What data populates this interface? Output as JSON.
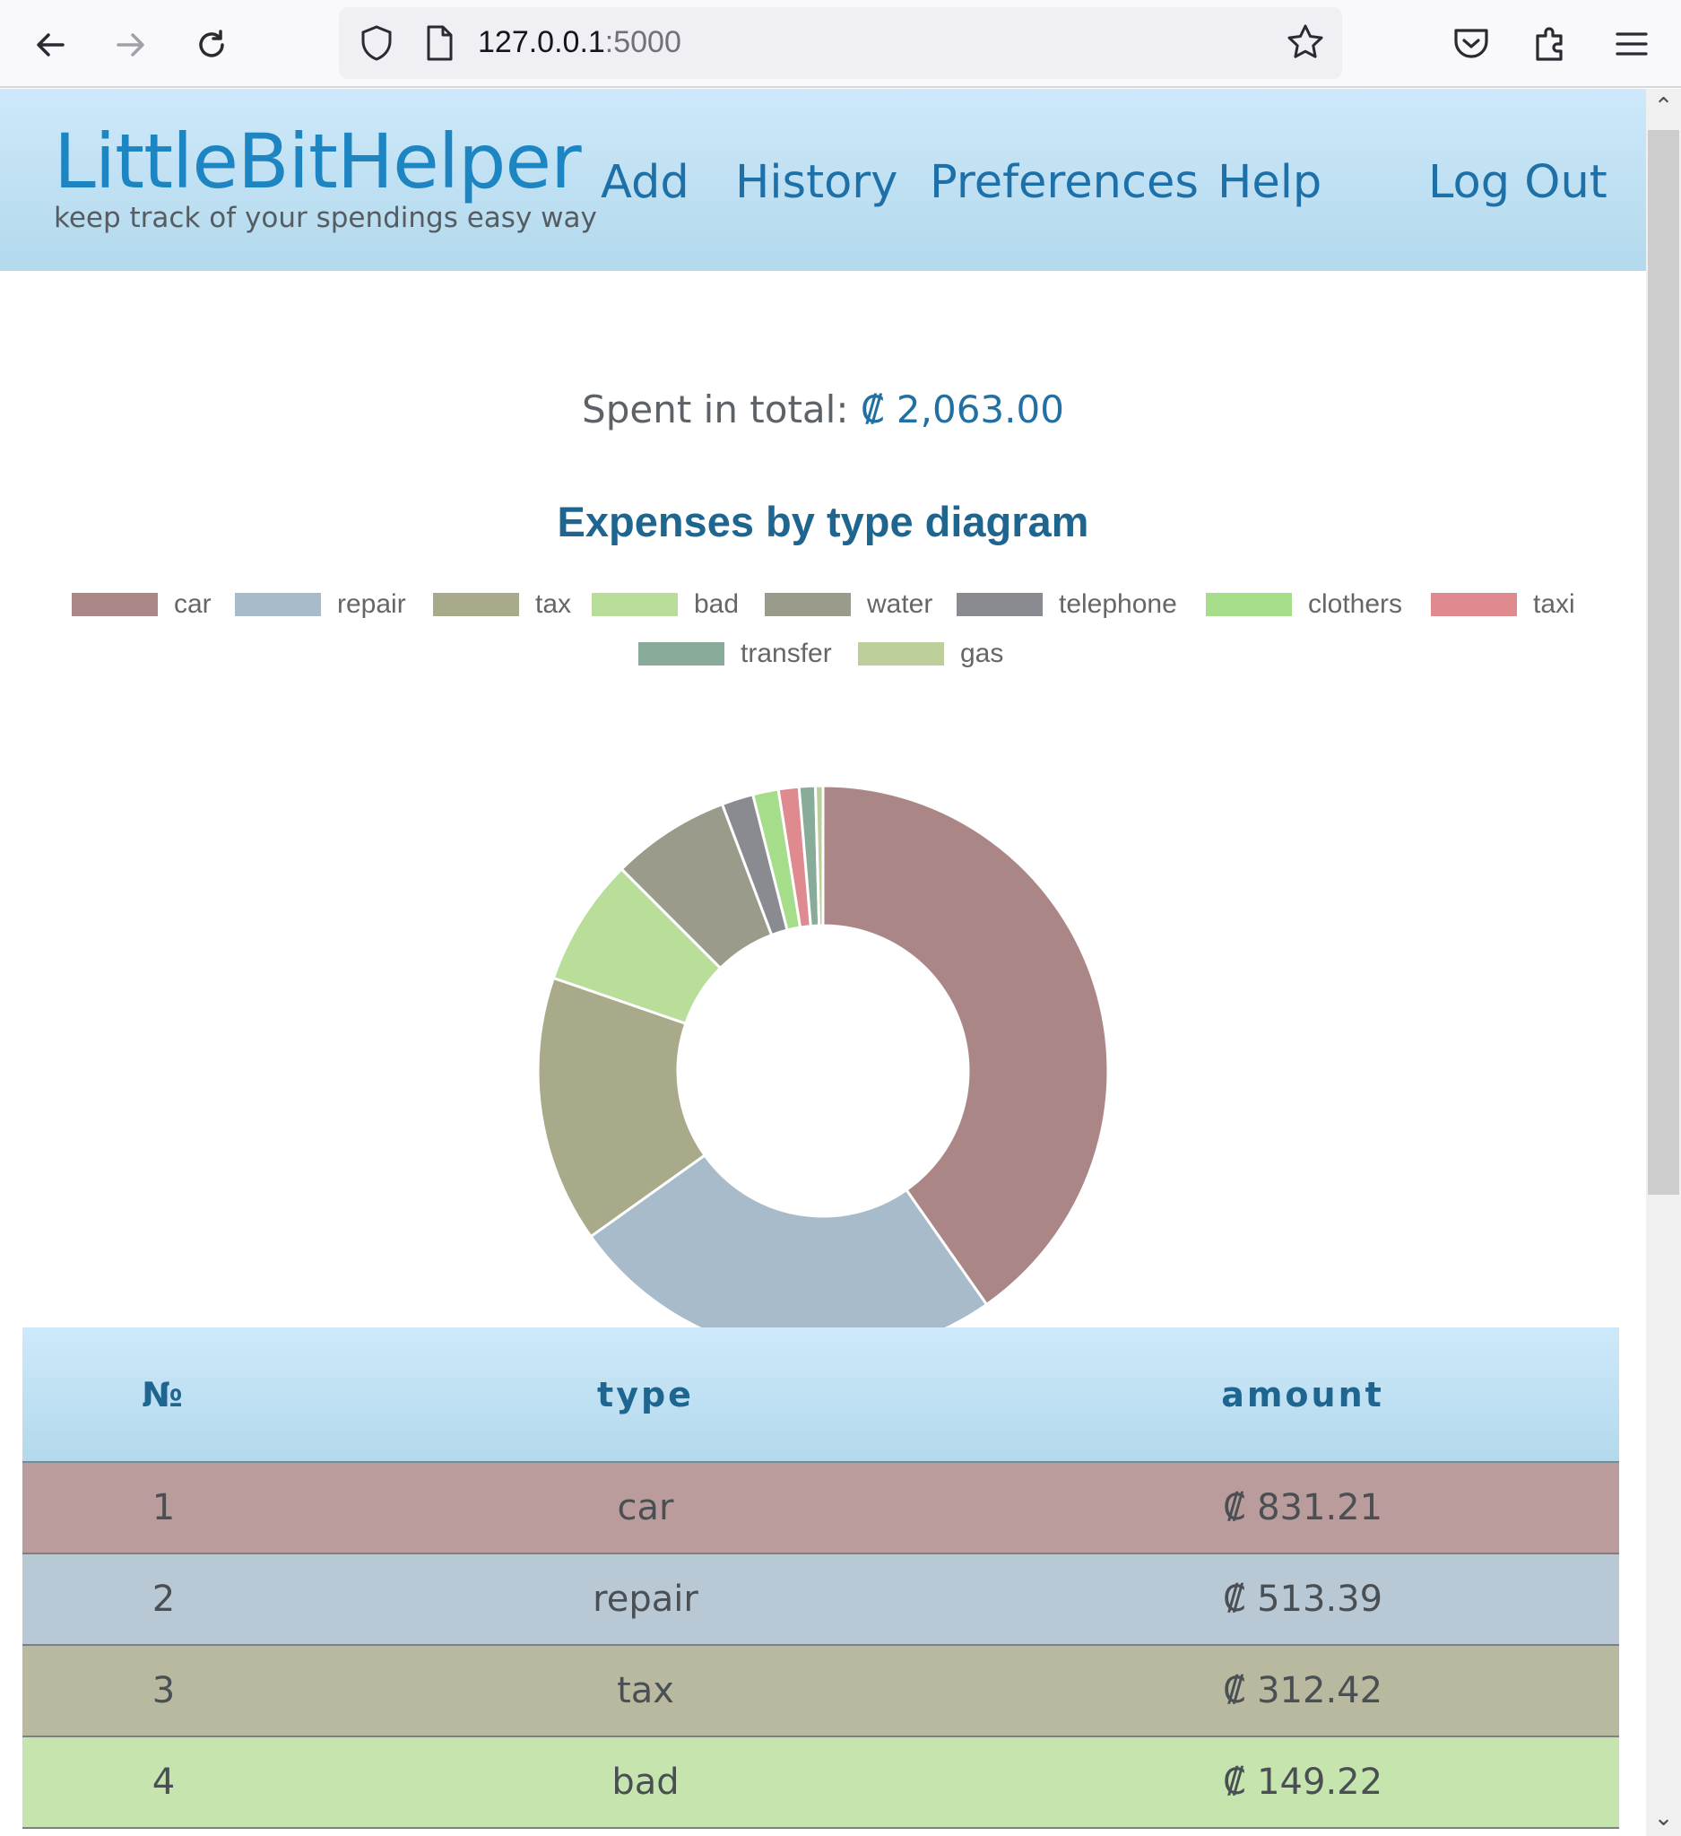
{
  "browser": {
    "url_host": "127.0.0.1",
    "url_port": ":5000"
  },
  "header": {
    "brand": "LittleBitHelper",
    "tagline": "keep track of your spendings easy way",
    "nav": {
      "add": "Add",
      "history": "History",
      "preferences": "Preferences",
      "help": "Help",
      "logout": "Log Out"
    }
  },
  "summary": {
    "label": "Spent in total:",
    "amount": "₡ 2,063.00"
  },
  "chart_data": {
    "type": "pie",
    "variant": "doughnut",
    "title": "Expenses by type diagram",
    "categories": [
      "car",
      "repair",
      "tax",
      "bad",
      "water",
      "telephone",
      "clothers",
      "taxi",
      "transfer",
      "gas"
    ],
    "values": [
      831.21,
      513.39,
      312.42,
      149.22,
      139.0,
      37.0,
      30.0,
      24.0,
      19.0,
      8.76
    ],
    "colors": [
      "#ab8687",
      "#a8bbca",
      "#a8aa8a",
      "#b8de99",
      "#9a9b8b",
      "#8a8a91",
      "#a6dd8a",
      "#de8a8e",
      "#88ab9a",
      "#bccf9a"
    ],
    "legend_position": "top"
  },
  "table": {
    "headers": [
      "№",
      "type",
      "amount"
    ],
    "rows": [
      {
        "num": "1",
        "type": "car",
        "amount": "₡ 831.21",
        "color": "#bb9c9d"
      },
      {
        "num": "2",
        "type": "repair",
        "amount": "₡ 513.39",
        "color": "#b9c8d5"
      },
      {
        "num": "3",
        "type": "tax",
        "amount": "₡ 312.42",
        "color": "#b9b9a0"
      },
      {
        "num": "4",
        "type": "bad",
        "amount": "₡ 149.22",
        "color": "#c6e5ae"
      }
    ]
  }
}
